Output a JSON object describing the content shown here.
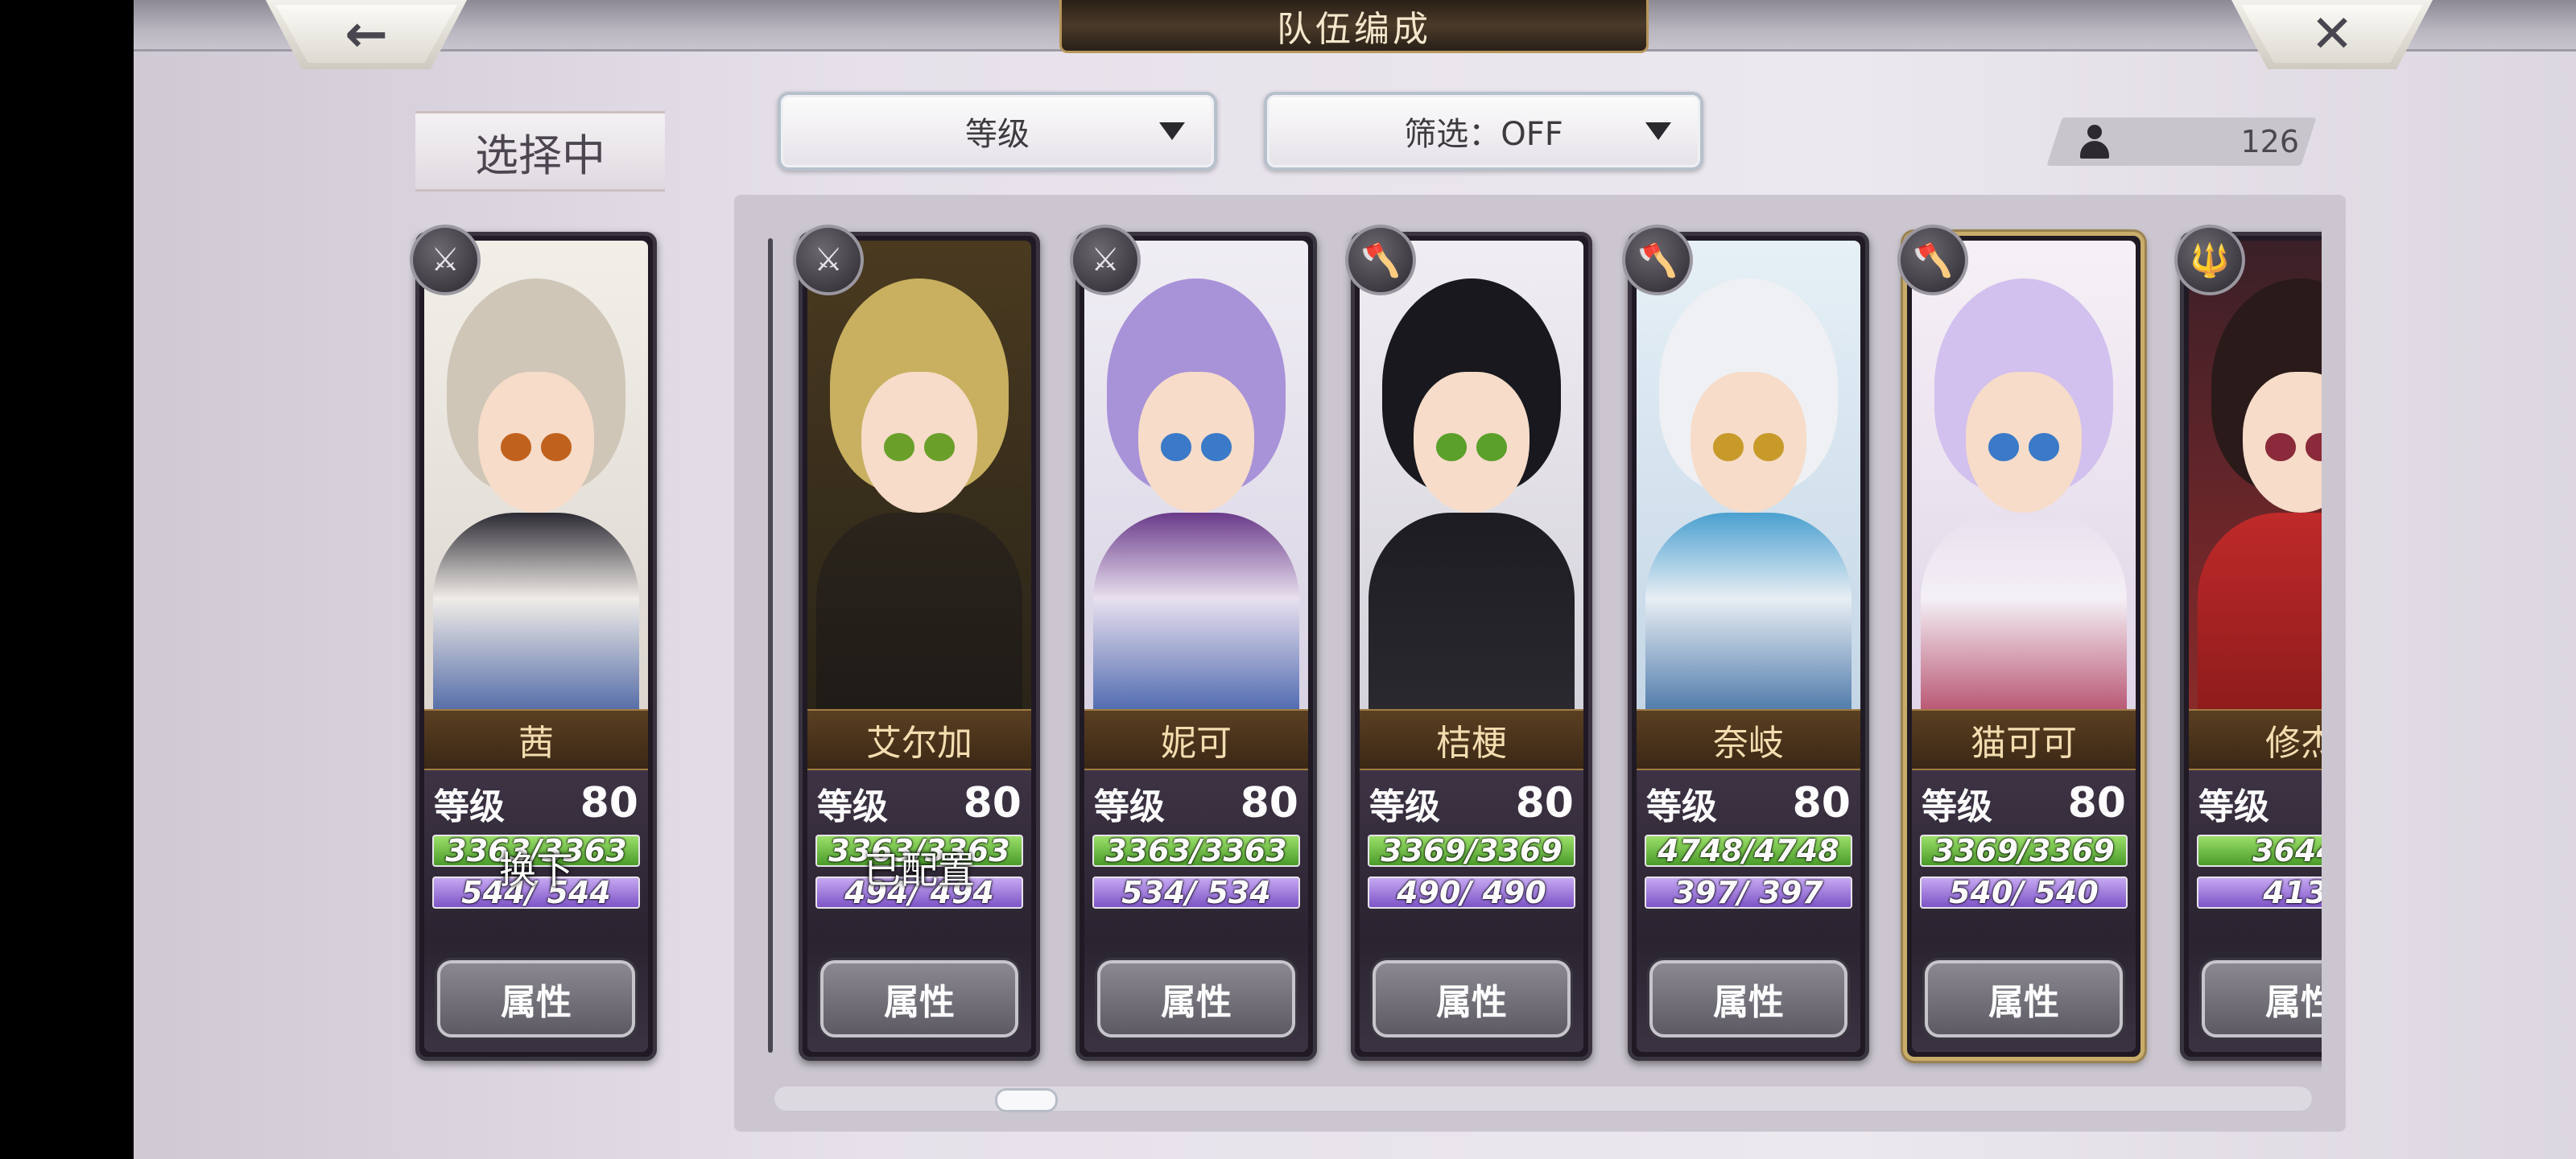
{
  "header": {
    "title": "队伍编成",
    "back_icon": "←",
    "close_icon": "✕"
  },
  "selecting_label": "选择中",
  "sort_dropdown": {
    "label": "等级"
  },
  "filter_dropdown": {
    "label": "筛选：OFF"
  },
  "unit_count": "126",
  "selected_card": {
    "name": "茜",
    "level_label": "等级",
    "level": "80",
    "hp": "3363/3363",
    "mp": "544/ 544",
    "overlay": "换下",
    "button": "属性"
  },
  "cards": [
    {
      "name": "艾尔加",
      "level_label": "等级",
      "level": "80",
      "hp": "3363/3363",
      "mp": "494/ 494",
      "overlay": "已配置",
      "button": "属性"
    },
    {
      "name": "妮可",
      "level_label": "等级",
      "level": "80",
      "hp": "3363/3363",
      "mp": "534/ 534",
      "overlay": "",
      "button": "属性"
    },
    {
      "name": "桔梗",
      "level_label": "等级",
      "level": "80",
      "hp": "3369/3369",
      "mp": "490/ 490",
      "overlay": "",
      "button": "属性"
    },
    {
      "name": "奈岐",
      "level_label": "等级",
      "level": "80",
      "hp": "4748/4748",
      "mp": "397/ 397",
      "overlay": "",
      "button": "属性"
    },
    {
      "name": "猫可可",
      "level_label": "等级",
      "level": "80",
      "hp": "3369/3369",
      "mp": "540/ 540",
      "overlay": "",
      "button": "属性"
    },
    {
      "name": "修杰",
      "level_label": "等级",
      "level": "",
      "hp": "3644/",
      "mp": "413/",
      "overlay": "",
      "button": "属性"
    }
  ],
  "colors": {
    "hp_bar": "#6fbf45",
    "mp_bar": "#9b76dc",
    "name_text": "#f3ddb0",
    "selected_border": "#c8ad6a"
  },
  "icons": {
    "weapon_sword": "sword-icon",
    "weapon_axe": "axe-icon",
    "weapon_spear": "spear-icon",
    "count": "person-icon"
  }
}
